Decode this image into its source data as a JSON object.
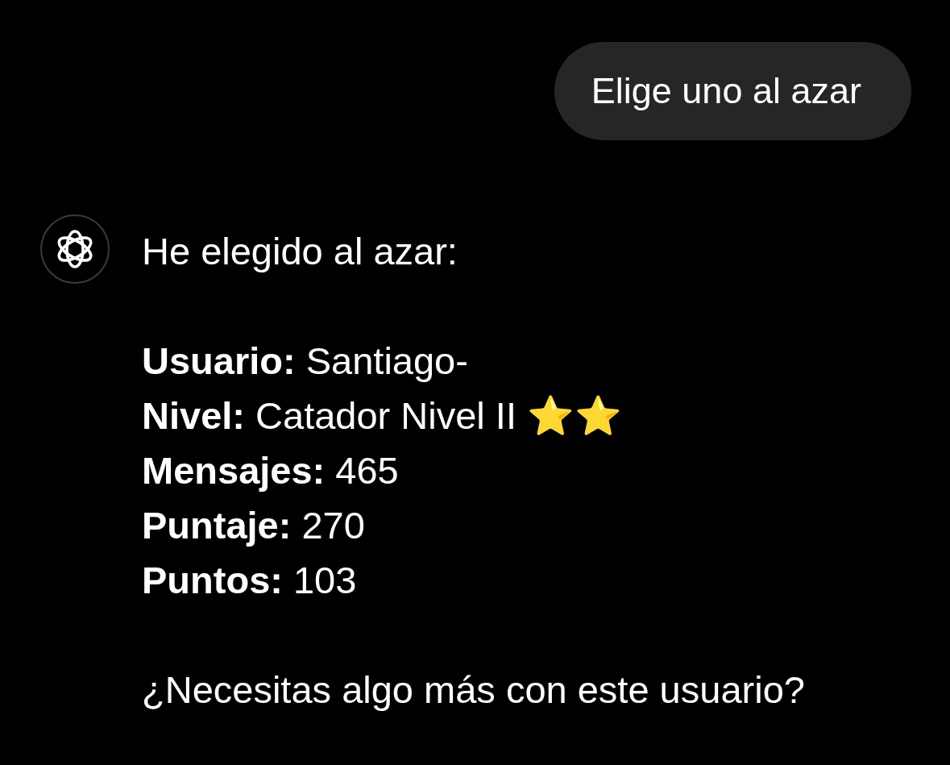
{
  "user_message": {
    "text": "Elige uno al azar"
  },
  "assistant_message": {
    "intro": "He elegido al azar:",
    "fields": [
      {
        "text": "**Usuario:** Santiago-"
      },
      {
        "text": "**Nivel:** Catador Nivel II ⭐⭐"
      },
      {
        "text": "**Mensajes:** 465"
      },
      {
        "text": "**Puntaje:** 270"
      },
      {
        "text": "**Puntos:** 103"
      }
    ],
    "closing": "¿Necesitas algo más con este usuario?"
  }
}
